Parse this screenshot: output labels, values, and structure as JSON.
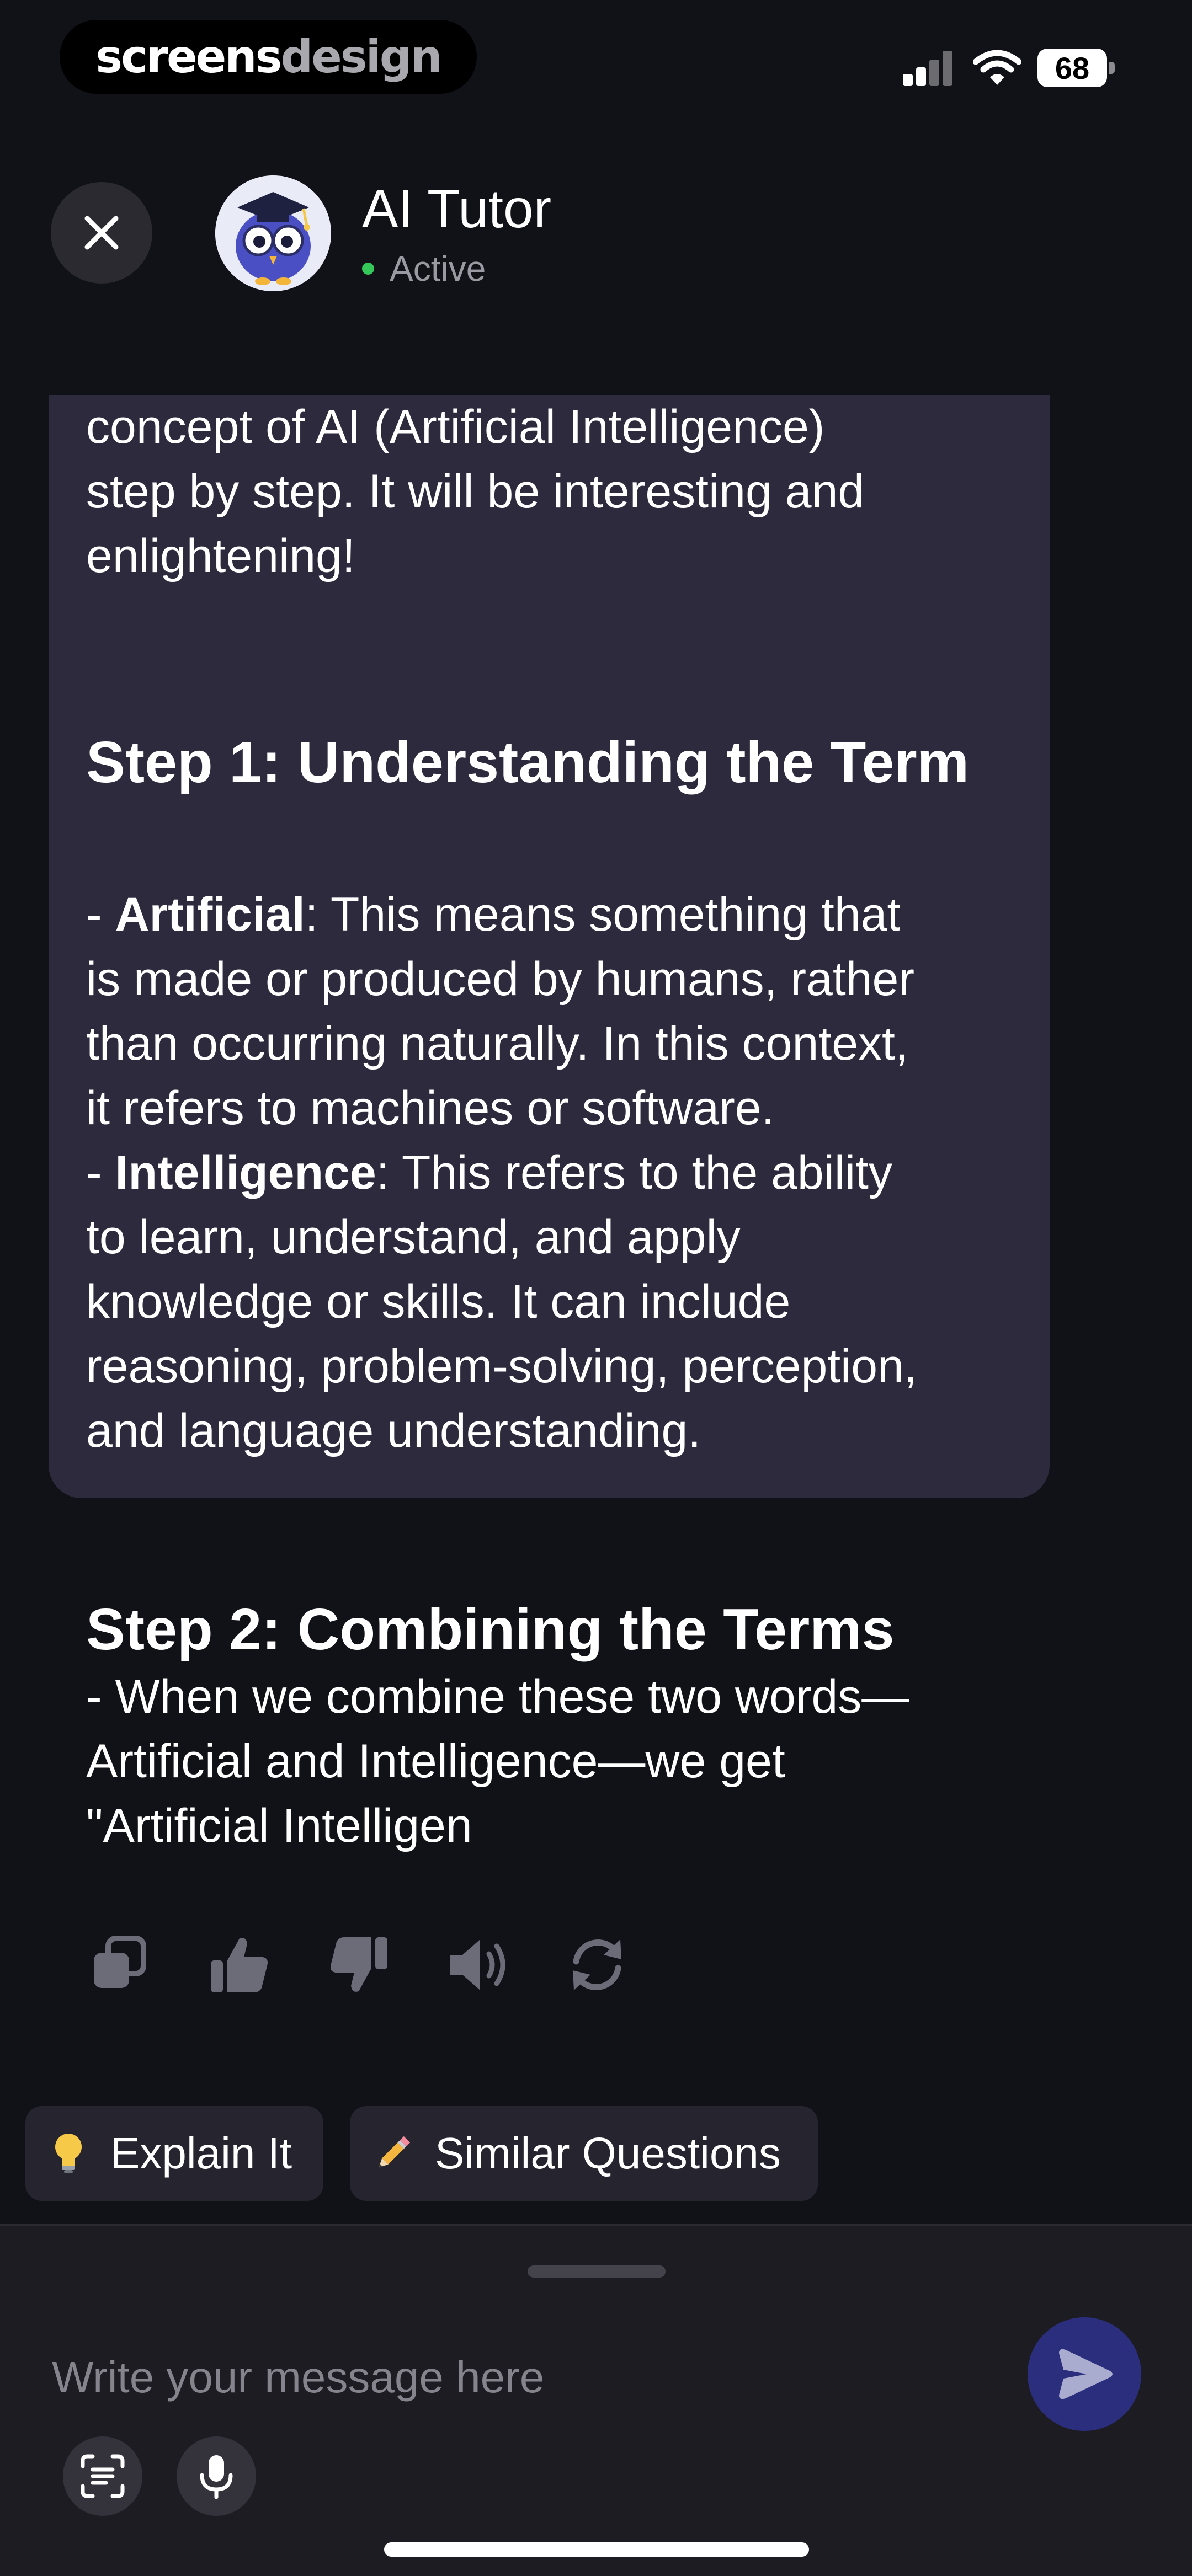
{
  "status_bar": {
    "brand_part1": "screens",
    "brand_part2": "design",
    "battery_level": "68"
  },
  "header": {
    "title": "AI Tutor",
    "status": "Active",
    "close_label": "Close"
  },
  "message": {
    "intro_lines": "concept of AI (Artificial Intelligence)\nstep by step. It will be interesting and\nenlightening!",
    "step1_heading": "Step 1: Understanding the Term",
    "step1_artificial_term": "Artificial",
    "step1_artificial_rest": ": This means something that\nis made or produced by humans, rather\nthan occurring naturally. In this context,\nit refers to machines or software.",
    "step1_intelligence_term": "Intelligence",
    "step1_intelligence_rest": ": This refers to the ability\nto learn, understand, and apply\nknowledge or skills. It can include\nreasoning, problem-solving, perception,\nand language understanding.",
    "bullet": "- ",
    "step2_heading": "Step 2: Combining the Terms",
    "step2_text": "- When we combine these two words—\nArtificial and Intelligence—we get\n\"Artificial Intelligen"
  },
  "actions": [
    {
      "icon": "copy-icon"
    },
    {
      "icon": "thumbs-up-icon"
    },
    {
      "icon": "thumbs-down-icon"
    },
    {
      "icon": "speaker-icon"
    },
    {
      "icon": "regenerate-icon"
    }
  ],
  "chips": [
    {
      "label": "Explain It",
      "icon": "lightbulb-icon"
    },
    {
      "label": "Similar Questions",
      "icon": "pencil-icon"
    }
  ],
  "composer": {
    "placeholder": "Write your message here"
  },
  "colors": {
    "background": "#111118",
    "bubble": "#2c2a3c",
    "chip": "#26252f",
    "send_button": "#2a2e7c",
    "active_dot": "#35c759"
  }
}
